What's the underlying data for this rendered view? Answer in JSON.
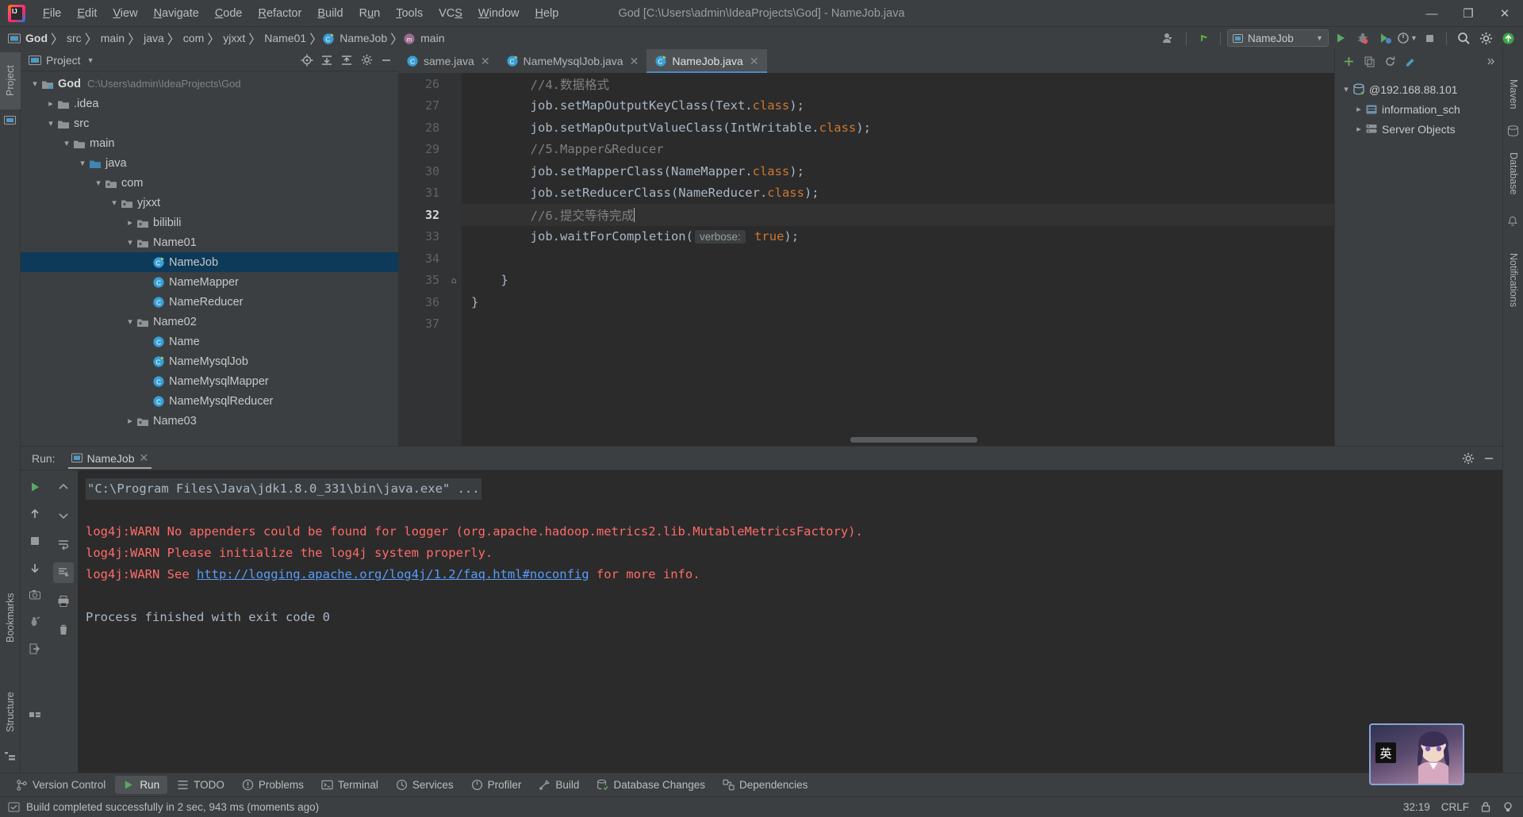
{
  "window": {
    "title": "God [C:\\Users\\admin\\IdeaProjects\\God] - NameJob.java",
    "minimize": "—",
    "maximize": "❐",
    "close": "✕"
  },
  "menu": {
    "items": [
      {
        "label": "File",
        "mnemonic": "F"
      },
      {
        "label": "Edit",
        "mnemonic": "E"
      },
      {
        "label": "View",
        "mnemonic": "V"
      },
      {
        "label": "Navigate",
        "mnemonic": "N"
      },
      {
        "label": "Code",
        "mnemonic": "C"
      },
      {
        "label": "Refactor",
        "mnemonic": "R"
      },
      {
        "label": "Build",
        "mnemonic": "B"
      },
      {
        "label": "Run",
        "mnemonic": "u"
      },
      {
        "label": "Tools",
        "mnemonic": "T"
      },
      {
        "label": "VCS",
        "mnemonic": "S"
      },
      {
        "label": "Window",
        "mnemonic": "W"
      },
      {
        "label": "Help",
        "mnemonic": "H"
      }
    ]
  },
  "breadcrumb": {
    "items": [
      {
        "label": "God",
        "icon": "project-icon",
        "bold": true
      },
      {
        "label": "src",
        "icon": "folder-icon",
        "bold": false
      },
      {
        "label": "main",
        "icon": "folder-icon",
        "bold": false
      },
      {
        "label": "java",
        "icon": "folder-icon",
        "bold": false
      },
      {
        "label": "com",
        "icon": "package-icon",
        "bold": false
      },
      {
        "label": "yjxxt",
        "icon": "package-icon",
        "bold": false
      },
      {
        "label": "Name01",
        "icon": "package-icon",
        "bold": false
      },
      {
        "label": "NameJob",
        "icon": "java-class-icon",
        "bold": false
      },
      {
        "label": "main",
        "icon": "method-icon",
        "bold": false
      }
    ],
    "separator": "〉"
  },
  "toolbar": {
    "account_icon": "user-icon",
    "vcs_update_icon": "vcs-update-icon",
    "run_config_name": "NameJob",
    "run_config_icon": "run-config-icon",
    "run_icon": "run-icon",
    "debug_icon": "debug-icon",
    "run_coverage_icon": "run-coverage-icon",
    "profiler_icon": "profiler-icon",
    "stop_icon": "stop-icon",
    "search_icon": "search-icon",
    "settings_icon": "gear-icon",
    "updates_icon": "update-icon"
  },
  "left_stripe": {
    "tabs": [
      {
        "label": "Project",
        "active": true
      },
      {
        "label": "Bookmarks",
        "active": false
      },
      {
        "label": "Structure",
        "active": false
      }
    ]
  },
  "right_stripe": {
    "tabs": [
      {
        "label": "Maven"
      },
      {
        "label": "Database"
      },
      {
        "label": "Notifications"
      }
    ]
  },
  "project_panel": {
    "title": "Project",
    "dropdown_icon": "chevron-down-icon",
    "header_icons": [
      "locate-icon",
      "expand-all-icon",
      "collapse-all-icon",
      "gear-icon",
      "hide-icon"
    ],
    "tree": [
      {
        "depth": 0,
        "arrow": "down",
        "icon": "module-icon",
        "label": "God",
        "sub": "C:\\Users\\admin\\IdeaProjects\\God",
        "bold": true,
        "selected": false
      },
      {
        "depth": 1,
        "arrow": "right",
        "icon": "folder-icon",
        "label": ".idea",
        "sub": "",
        "bold": false,
        "selected": false
      },
      {
        "depth": 1,
        "arrow": "down",
        "icon": "folder-icon",
        "label": "src",
        "sub": "",
        "bold": false,
        "selected": false
      },
      {
        "depth": 2,
        "arrow": "down",
        "icon": "folder-icon",
        "label": "main",
        "sub": "",
        "bold": false,
        "selected": false
      },
      {
        "depth": 3,
        "arrow": "down",
        "icon": "source-icon",
        "label": "java",
        "sub": "",
        "bold": false,
        "selected": false
      },
      {
        "depth": 4,
        "arrow": "down",
        "icon": "package-icon",
        "label": "com",
        "sub": "",
        "bold": false,
        "selected": false
      },
      {
        "depth": 5,
        "arrow": "down",
        "icon": "package-icon",
        "label": "yjxxt",
        "sub": "",
        "bold": false,
        "selected": false
      },
      {
        "depth": 6,
        "arrow": "right",
        "icon": "package-icon",
        "label": "bilibili",
        "sub": "",
        "bold": false,
        "selected": false
      },
      {
        "depth": 6,
        "arrow": "down",
        "icon": "package-icon",
        "label": "Name01",
        "sub": "",
        "bold": false,
        "selected": false
      },
      {
        "depth": 7,
        "arrow": "none",
        "icon": "runnable-class-icon",
        "label": "NameJob",
        "sub": "",
        "bold": false,
        "selected": true
      },
      {
        "depth": 7,
        "arrow": "none",
        "icon": "java-class-icon",
        "label": "NameMapper",
        "sub": "",
        "bold": false,
        "selected": false
      },
      {
        "depth": 7,
        "arrow": "none",
        "icon": "java-class-icon",
        "label": "NameReducer",
        "sub": "",
        "bold": false,
        "selected": false
      },
      {
        "depth": 6,
        "arrow": "down",
        "icon": "package-icon",
        "label": "Name02",
        "sub": "",
        "bold": false,
        "selected": false
      },
      {
        "depth": 7,
        "arrow": "none",
        "icon": "java-class-icon",
        "label": "Name",
        "sub": "",
        "bold": false,
        "selected": false
      },
      {
        "depth": 7,
        "arrow": "none",
        "icon": "runnable-class-icon",
        "label": "NameMysqlJob",
        "sub": "",
        "bold": false,
        "selected": false
      },
      {
        "depth": 7,
        "arrow": "none",
        "icon": "java-class-icon",
        "label": "NameMysqlMapper",
        "sub": "",
        "bold": false,
        "selected": false
      },
      {
        "depth": 7,
        "arrow": "none",
        "icon": "java-class-icon",
        "label": "NameMysqlReducer",
        "sub": "",
        "bold": false,
        "selected": false
      },
      {
        "depth": 6,
        "arrow": "right",
        "icon": "package-icon",
        "label": "Name03",
        "sub": "",
        "bold": false,
        "selected": false
      }
    ]
  },
  "editor": {
    "tabs": [
      {
        "label": "same.java",
        "icon": "java-class-icon",
        "active": false,
        "close": "✕"
      },
      {
        "label": "NameMysqlJob.java",
        "icon": "runnable-class-icon",
        "active": false,
        "close": "✕"
      },
      {
        "label": "NameJob.java",
        "icon": "runnable-class-icon",
        "active": true,
        "close": "✕"
      }
    ],
    "tabbar_icons": [
      "more-icon",
      "D-icon"
    ],
    "inspection_status": "✓",
    "lines": [
      {
        "num": "26",
        "current": false,
        "fold": "",
        "indent": 0,
        "parts": [
          {
            "t": "        //4.数据格式",
            "c": "cm"
          }
        ]
      },
      {
        "num": "27",
        "current": false,
        "fold": "",
        "indent": 0,
        "parts": [
          {
            "t": "        job.setMapOutputKeyClass(Text.",
            "c": "plain"
          },
          {
            "t": "class",
            "c": "kw"
          },
          {
            "t": ");",
            "c": "plain"
          }
        ]
      },
      {
        "num": "28",
        "current": false,
        "fold": "",
        "indent": 0,
        "parts": [
          {
            "t": "        job.setMapOutputValueClass(IntWritable.",
            "c": "plain"
          },
          {
            "t": "class",
            "c": "kw"
          },
          {
            "t": ");",
            "c": "plain"
          }
        ]
      },
      {
        "num": "29",
        "current": false,
        "fold": "",
        "indent": 0,
        "parts": [
          {
            "t": "        //5.Mapper&Reducer",
            "c": "cm"
          }
        ]
      },
      {
        "num": "30",
        "current": false,
        "fold": "",
        "indent": 0,
        "parts": [
          {
            "t": "        job.setMapperClass(NameMapper.",
            "c": "plain"
          },
          {
            "t": "class",
            "c": "kw"
          },
          {
            "t": ");",
            "c": "plain"
          }
        ]
      },
      {
        "num": "31",
        "current": false,
        "fold": "",
        "indent": 0,
        "parts": [
          {
            "t": "        job.setReducerClass(NameReducer.",
            "c": "plain"
          },
          {
            "t": "class",
            "c": "kw"
          },
          {
            "t": ");",
            "c": "plain"
          }
        ]
      },
      {
        "num": "32",
        "current": true,
        "fold": "",
        "indent": 0,
        "parts": [
          {
            "t": "        //6.提交等待完成",
            "c": "cm"
          },
          {
            "t": "CARET",
            "c": "caret"
          }
        ]
      },
      {
        "num": "33",
        "current": false,
        "fold": "",
        "indent": 0,
        "parts": [
          {
            "t": "        job.waitForCompletion(",
            "c": "plain"
          },
          {
            "t": "verbose:",
            "c": "hint"
          },
          {
            "t": " ",
            "c": "plain"
          },
          {
            "t": "true",
            "c": "kw"
          },
          {
            "t": ");",
            "c": "plain"
          }
        ]
      },
      {
        "num": "34",
        "current": false,
        "fold": "",
        "indent": 0,
        "parts": []
      },
      {
        "num": "35",
        "current": false,
        "fold": "⌂",
        "indent": 0,
        "parts": [
          {
            "t": "    }",
            "c": "plain"
          }
        ]
      },
      {
        "num": "36",
        "current": false,
        "fold": "",
        "indent": 0,
        "parts": [
          {
            "t": "}",
            "c": "plain"
          }
        ]
      },
      {
        "num": "37",
        "current": false,
        "fold": "",
        "indent": 0,
        "parts": []
      }
    ]
  },
  "database_panel": {
    "header_icons": [
      "add-icon",
      "copy-icon",
      "refresh-icon",
      "edit-icon",
      "expand-icon"
    ],
    "tree": [
      {
        "depth": 0,
        "arrow": "down",
        "icon": "datasource-icon",
        "label": "@192.168.88.101"
      },
      {
        "depth": 1,
        "arrow": "right",
        "icon": "schema-icon",
        "label": "information_sch"
      },
      {
        "depth": 1,
        "arrow": "right",
        "icon": "server-objects-icon",
        "label": "Server Objects"
      }
    ]
  },
  "run_panel": {
    "label": "Run:",
    "tab_label": "NameJob",
    "tab_icon": "run-config-icon",
    "tab_close": "✕",
    "header_icons": [
      "gear-icon",
      "hide-icon"
    ],
    "sidebar_icons": [
      "rerun-icon",
      "up-icon",
      "stop-icon",
      "down-icon",
      "camera-icon",
      "debug-attach-icon",
      "export-icon",
      "bookmarks-icon"
    ],
    "sidebar2_icons": [
      "chevron-up-icon",
      "chevron-down-icon",
      "soft-wrap-icon",
      "scroll-to-end-icon",
      "print-icon",
      "trash-icon"
    ],
    "console": [
      {
        "segments": [
          {
            "t": "\"C:\\Program Files\\Java\\jdk1.8.0_331\\bin\\java.exe\" ...",
            "c": "cmd"
          }
        ]
      },
      {
        "segments": [
          {
            "t": "",
            "c": "plain"
          }
        ]
      },
      {
        "segments": [
          {
            "t": "log4j:WARN No appenders could be found for logger (org.apache.hadoop.metrics2.lib.MutableMetricsFactory).",
            "c": "warn"
          }
        ]
      },
      {
        "segments": [
          {
            "t": "log4j:WARN Please initialize the log4j system properly.",
            "c": "warn"
          }
        ]
      },
      {
        "segments": [
          {
            "t": "log4j:WARN See ",
            "c": "warn"
          },
          {
            "t": "http://logging.apache.org/log4j/1.2/faq.html#noconfig",
            "c": "link"
          },
          {
            "t": " for more info.",
            "c": "warn"
          }
        ]
      },
      {
        "segments": [
          {
            "t": "",
            "c": "plain"
          }
        ]
      },
      {
        "segments": [
          {
            "t": "Process finished with exit code 0",
            "c": "plain"
          }
        ]
      }
    ]
  },
  "bottom_tabs": [
    {
      "label": "Version Control",
      "icon": "branch-icon",
      "active": false
    },
    {
      "label": "Run",
      "icon": "run-icon",
      "active": true
    },
    {
      "label": "TODO",
      "icon": "todo-icon",
      "active": false
    },
    {
      "label": "Problems",
      "icon": "problems-icon",
      "active": false
    },
    {
      "label": "Terminal",
      "icon": "terminal-icon",
      "active": false
    },
    {
      "label": "Services",
      "icon": "services-icon",
      "active": false
    },
    {
      "label": "Profiler",
      "icon": "profiler-icon",
      "active": false
    },
    {
      "label": "Build",
      "icon": "build-icon",
      "active": false
    },
    {
      "label": "Database Changes",
      "icon": "db-changes-icon",
      "active": false
    },
    {
      "label": "Dependencies",
      "icon": "dependencies-icon",
      "active": false
    }
  ],
  "statusbar": {
    "icon": "build-status-icon",
    "message": "Build completed successfully in 2 sec, 943 ms (moments ago)",
    "caret_position": "32:19",
    "line_separator": "CRLF",
    "lock_icon": "lock-icon",
    "tips_icon": "tips-icon"
  },
  "float_widget": {
    "badge": "英"
  },
  "colors": {
    "accent": "#4a88c7",
    "selection": "#0d3a58",
    "panel_bg": "#3c3f41",
    "editor_bg": "#2b2b2b",
    "keyword": "#cc7832",
    "warn": "#ff6b68",
    "link": "#589df6",
    "comment": "#808080"
  }
}
